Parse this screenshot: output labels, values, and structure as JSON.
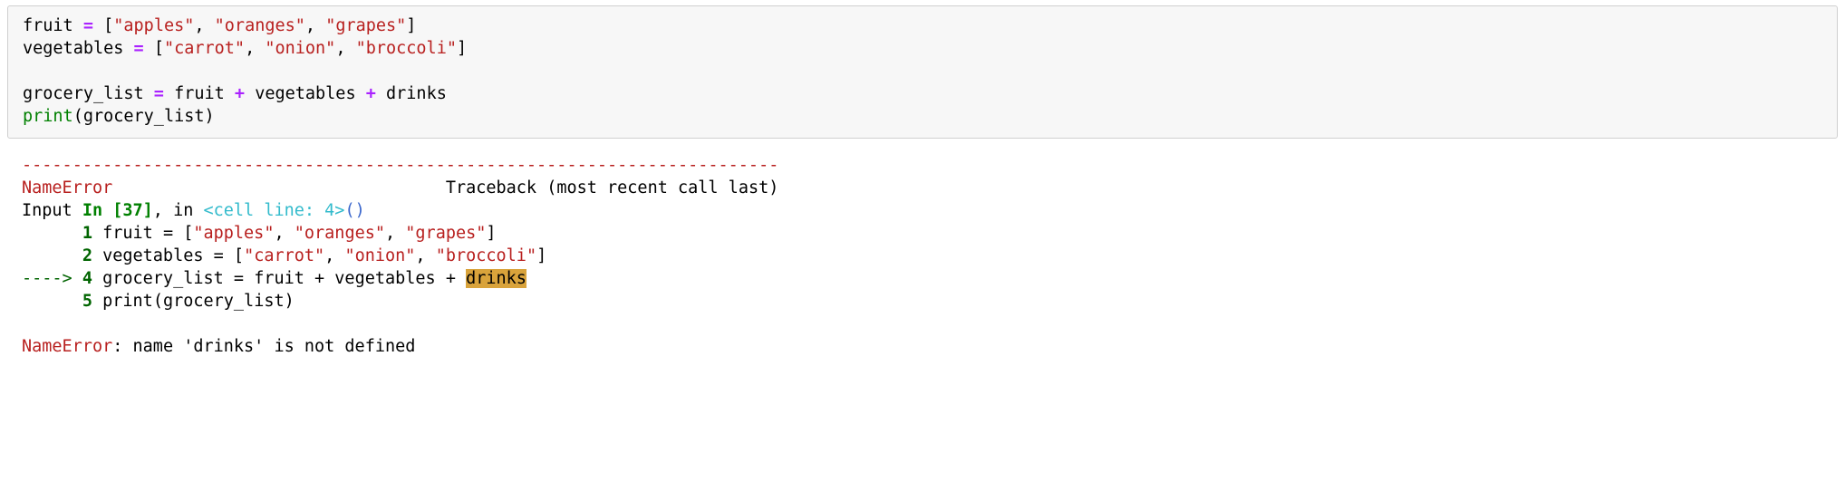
{
  "code": {
    "line1": {
      "var": "fruit",
      "eq": " = ",
      "lb": "[",
      "s1": "\"apples\"",
      "c1": ", ",
      "s2": "\"oranges\"",
      "c2": ", ",
      "s3": "\"grapes\"",
      "rb": "]"
    },
    "line2": {
      "var": "vegetables",
      "eq": " = ",
      "lb": "[",
      "s1": "\"carrot\"",
      "c1": ", ",
      "s2": "\"onion\"",
      "c2": ", ",
      "s3": "\"broccoli\"",
      "rb": "]"
    },
    "line3": "",
    "line4": {
      "var": "grocery_list",
      "eq": " = ",
      "a": "fruit",
      "p1": " + ",
      "b": "vegetables",
      "p2": " + ",
      "c": "drinks"
    },
    "line5": {
      "fn": "print",
      "lp": "(",
      "arg": "grocery_list",
      "rp": ")"
    }
  },
  "traceback": {
    "rule": "---------------------------------------------------------------------------",
    "errname": "NameError",
    "tbspacer": "                                 ",
    "tbtext": "Traceback (most recent call last)",
    "input_lbl": "Input ",
    "in_lbl": "In [37]",
    "comma_in": ", in ",
    "cellline": "<cell line: 4>",
    "parens": "()",
    "indent6": "      ",
    "indent_arrow": "----> ",
    "ln1": "1",
    "ln2": "2",
    "ln4": "4",
    "ln5": "5",
    "sp": " ",
    "l1": {
      "var": "fruit ",
      "eq": "=",
      "sp": " ",
      "lb": "[",
      "s1": "\"apples\"",
      "c1": ", ",
      "s2": "\"oranges\"",
      "c2": ", ",
      "s3": "\"grapes\"",
      "rb": "]"
    },
    "l2": {
      "var": "vegetables ",
      "eq": "=",
      "sp": " ",
      "lb": "[",
      "s1": "\"carrot\"",
      "c1": ", ",
      "s2": "\"onion\"",
      "c2": ", ",
      "s3": "\"broccoli\"",
      "rb": "]"
    },
    "l4": {
      "var": "grocery_list ",
      "eq": "=",
      "sp1": " ",
      "a": "fruit ",
      "p1": "+",
      "sp2": " ",
      "b": "vegetables ",
      "p2": "+",
      "sp3": " ",
      "c": "drinks"
    },
    "l5": {
      "fn": "print",
      "lp": "(",
      "arg": "grocery_list",
      "rp": ")"
    },
    "blank": "",
    "final_err": "NameError",
    "final_msg": ": name 'drinks' is not defined"
  }
}
